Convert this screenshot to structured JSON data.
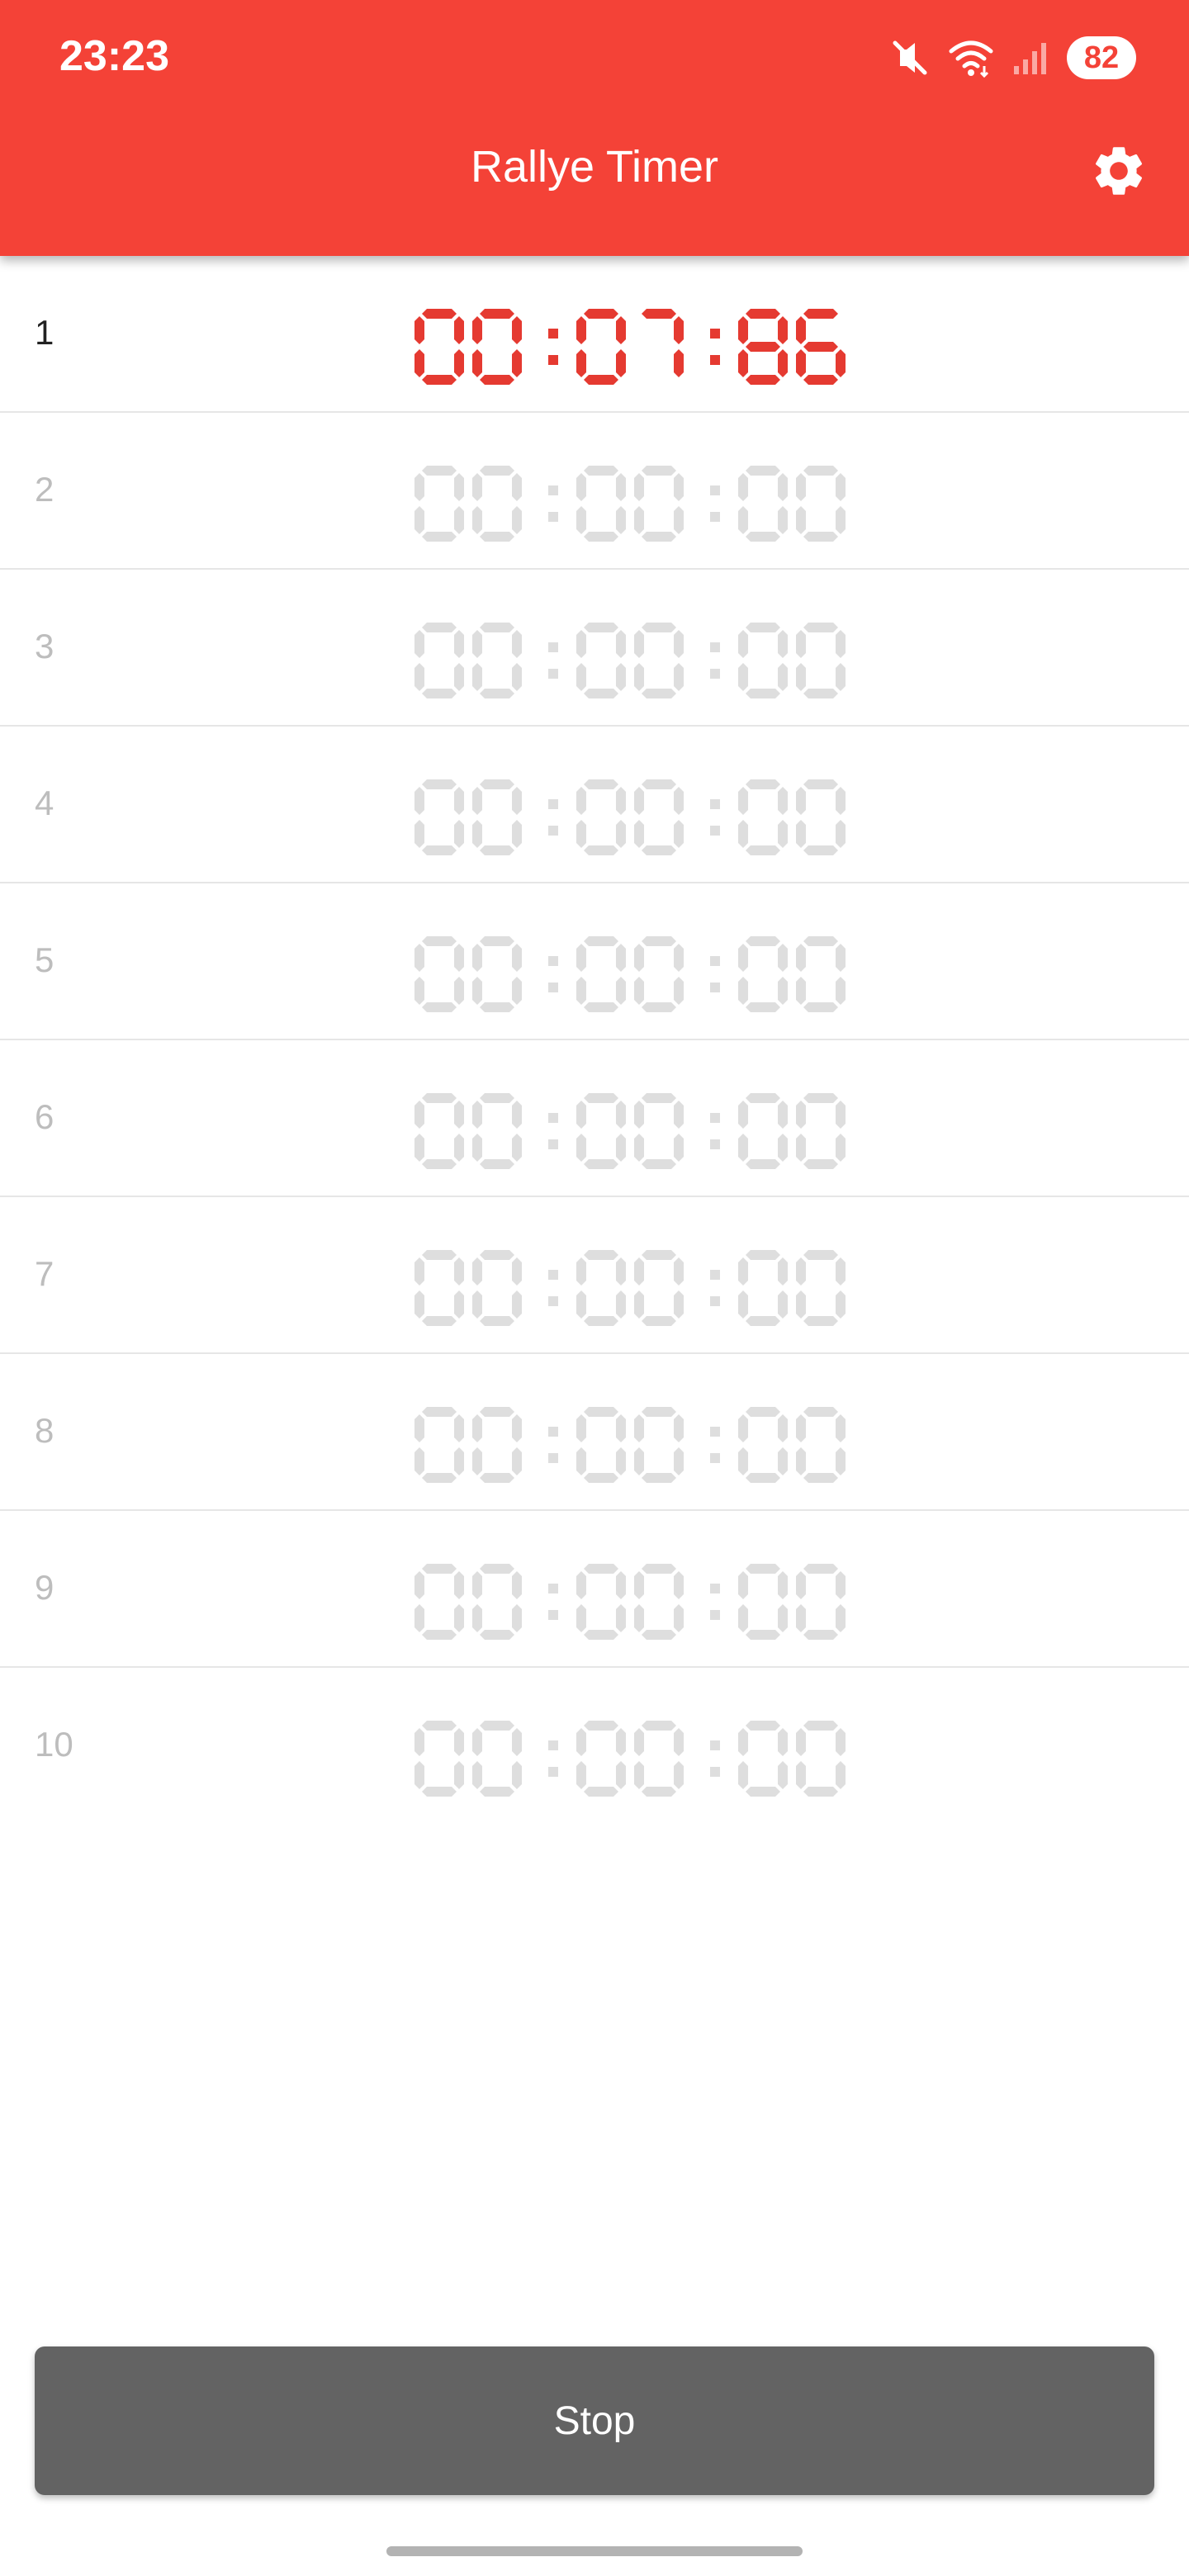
{
  "status_bar": {
    "time": "23:23",
    "battery": "82",
    "icons": [
      "mute-icon",
      "wifi-icon",
      "signal-icon"
    ]
  },
  "app_bar": {
    "title": "Rallye Timer",
    "settings_icon": "gear-icon"
  },
  "laps": [
    {
      "index": "1",
      "time": "00:07:86",
      "active": true
    },
    {
      "index": "2",
      "time": "00:00:00",
      "active": false
    },
    {
      "index": "3",
      "time": "00:00:00",
      "active": false
    },
    {
      "index": "4",
      "time": "00:00:00",
      "active": false
    },
    {
      "index": "5",
      "time": "00:00:00",
      "active": false
    },
    {
      "index": "6",
      "time": "00:00:00",
      "active": false
    },
    {
      "index": "7",
      "time": "00:00:00",
      "active": false
    },
    {
      "index": "8",
      "time": "00:00:00",
      "active": false
    },
    {
      "index": "9",
      "time": "00:00:00",
      "active": false
    },
    {
      "index": "10",
      "time": "00:00:00",
      "active": false
    }
  ],
  "stop_button": {
    "label": "Stop"
  },
  "colors": {
    "accent": "#f44237",
    "digit_active": "#e53a31",
    "digit_inactive": "#dedede",
    "button": "#636363"
  }
}
